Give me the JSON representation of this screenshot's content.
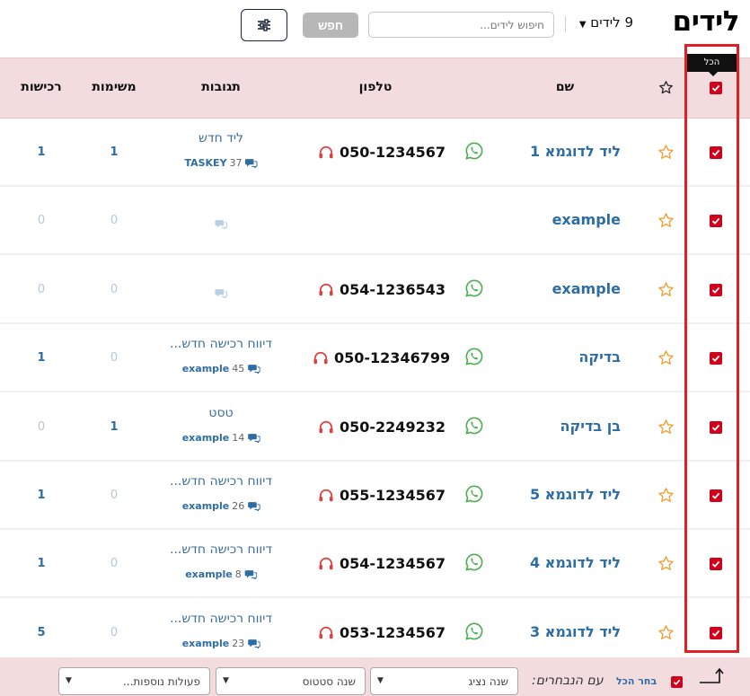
{
  "header": {
    "title": "לידים",
    "lead_count": "9 לידים",
    "search_placeholder": "חיפוש לידים...",
    "search_button": "חפש"
  },
  "tooltip": {
    "text": "הכל"
  },
  "columns": {
    "name": "שם",
    "phone": "טלפון",
    "responses": "תגובות",
    "tasks": "משימות",
    "purchases": "רכישות"
  },
  "rows": [
    {
      "name": "ליד לדוגמא 1",
      "phone": "050-1234567",
      "response_text": "ליד חדש",
      "response_count": "37",
      "response_source": "TASKEY",
      "tasks": "1",
      "purchases": "1"
    },
    {
      "name": "example",
      "phone": "",
      "response_text": "",
      "response_count": "",
      "response_source": "",
      "tasks": "0",
      "purchases": "0"
    },
    {
      "name": "example",
      "phone": "054-1236543",
      "response_text": "",
      "response_count": "",
      "response_source": "",
      "tasks": "0",
      "purchases": "0"
    },
    {
      "name": "בדיקה",
      "phone": "050-12346799",
      "response_text": "דיווח רכישה חדש...",
      "response_count": "45",
      "response_source": "example",
      "tasks": "0",
      "purchases": "1"
    },
    {
      "name": "בן בדיקה",
      "phone": "050-2249232",
      "response_text": "טסט",
      "response_count": "14",
      "response_source": "example",
      "tasks": "1",
      "purchases": "0"
    },
    {
      "name": "ליד לדוגמא 5",
      "phone": "055-1234567",
      "response_text": "דיווח רכישה חדש...",
      "response_count": "26",
      "response_source": "example",
      "tasks": "0",
      "purchases": "1"
    },
    {
      "name": "ליד לדוגמא 4",
      "phone": "054-1234567",
      "response_text": "דיווח רכישה חדש...",
      "response_count": "8",
      "response_source": "example",
      "tasks": "0",
      "purchases": "1"
    },
    {
      "name": "ליד לדוגמא 3",
      "phone": "053-1234567",
      "response_text": "דיווח רכישה חדש...",
      "response_count": "23",
      "response_source": "example",
      "tasks": "0",
      "purchases": "5"
    }
  ],
  "footer": {
    "select_all": "בחר הכל",
    "with_selected": "עם הנבחרים:",
    "change_rep": "שנה נציג",
    "change_status": "שנה סטטוס",
    "more_actions": "פעולות נוספות..."
  },
  "colors": {
    "accent_red": "#d0021b",
    "header_bg": "#f2dcde",
    "link_blue": "#2e6da4",
    "whatsapp_green": "#4caf50",
    "star_orange": "#f0a33a"
  }
}
